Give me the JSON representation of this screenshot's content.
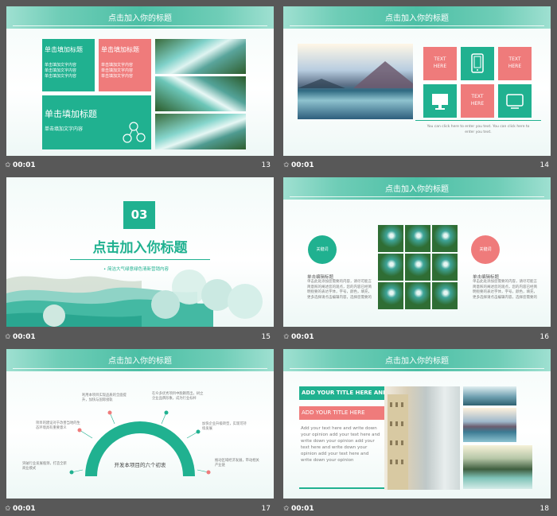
{
  "slides": [
    {
      "title": "点击加入你的标题",
      "time": "00:01",
      "num": "13",
      "box1_title": "单击填加标题",
      "box1_text": "单击填加文字内容\n单击填加文字内容\n单击填加文字内容",
      "box2_title": "单击填加标题",
      "box2_text": "单击填加文字内容\n单击填加文字内容\n单击填加文字内容",
      "box3_title": "单击填加标题",
      "box3_text": "单击填加文字内容"
    },
    {
      "title": "点击加入你的标题",
      "time": "00:01",
      "num": "14",
      "tile1": "TEXT\nHERE",
      "tile3": "TEXT\nHERE",
      "tile5": "TEXT\nHERE",
      "caption": "You can click here to enter you text. You can click here to enter you text."
    },
    {
      "time": "00:01",
      "num": "15",
      "badge": "03",
      "heading": "点击加入你标题",
      "sub": "简洁大气绿意绿色清新营销内容"
    },
    {
      "title": "点击加入你的标题",
      "time": "00:01",
      "num": "16",
      "left_circle": "关键词",
      "right_circle": "关键词",
      "left_head": "单击编辑标题",
      "right_head": "单击编辑标题",
      "left_text": "单击此处添加您需要的内容，请尽可能言简意赅的阐述您的观点，您的内容已经简明扼要的表达字体，字号，颜色，填充，更多选择请点击编辑内容，选择您需要的",
      "right_text": "单击此处添加您需要的内容，请尽可能言简意赅的阐述您的观点，您的内容已经简明扼要的表达字体，字号，颜色，填充，更多选择请点击编辑内容，选择您需要的"
    },
    {
      "title": "点击加入你的标题",
      "time": "00:01",
      "num": "17",
      "center": "开发本项目的六个初衷",
      "notes": [
        "利用本项目实现品质的全面提升，加快与国际接轨",
        "在众多优秀项目中脱颖而出，树立企业品牌形象，成为行业标杆",
        "项目的建设对于改善当地的生态环境具有重要意义",
        "加快企业升级转型，实现可持续发展",
        "突破行业发展瓶颈，打造全新商业模式",
        "推动区域经济发展，带动相关产业链"
      ]
    },
    {
      "title": "点击加入你的标题",
      "time": "00:01",
      "num": "18",
      "bar1": "ADD YOUR TITLE HERE AND",
      "bar2": "ADD YOUR  TITLE HERE",
      "body": "Add your text here and write down your opinion add your text here and write down your opinion  add your text here and write down your opinion  add your text here and write down your opinion"
    }
  ],
  "colors": {
    "teal": "#20b190",
    "pink": "#ef7b7b",
    "background": "#585858"
  }
}
